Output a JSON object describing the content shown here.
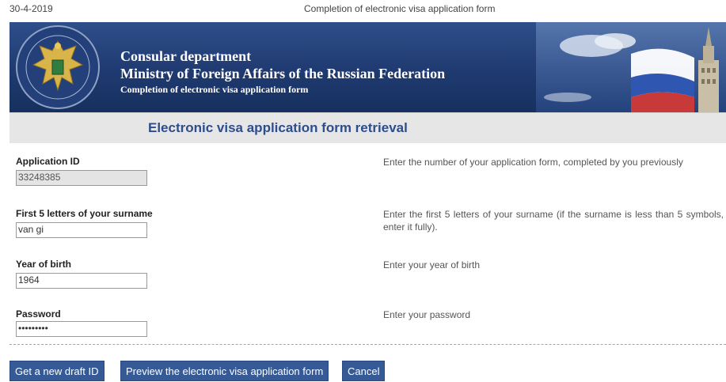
{
  "print_header": {
    "date": "30-4-2019",
    "title": "Completion of electronic visa application form"
  },
  "banner": {
    "line1": "Consular department",
    "line2": "Ministry of Foreign Affairs of the Russian Federation",
    "line3": "Completion of electronic visa application form"
  },
  "section": {
    "title": "Electronic visa application form retrieval"
  },
  "form": {
    "application_id": {
      "label": "Application ID",
      "value": "33248385",
      "hint": "Enter the number of your application form, completed by you previously"
    },
    "surname": {
      "label": "First 5 letters of your surname",
      "value": "van gi",
      "hint": "Enter the first 5 letters of your surname (if the surname is less than 5 symbols, enter it fully)."
    },
    "birth_year": {
      "label": "Year of birth",
      "value": "1964",
      "hint": "Enter your year of birth"
    },
    "password": {
      "label": "Password",
      "value": "•••••••••",
      "hint": "Enter your password"
    }
  },
  "buttons": {
    "new_draft": "Get a new draft ID",
    "preview": "Preview the electronic visa application form",
    "cancel": "Cancel"
  },
  "colors": {
    "banner_blue": "#1f3a70",
    "section_title_blue": "#2d4d8c",
    "button_blue": "#355a96"
  },
  "icons": {
    "emblem": "double-headed-eagle-emblem"
  }
}
